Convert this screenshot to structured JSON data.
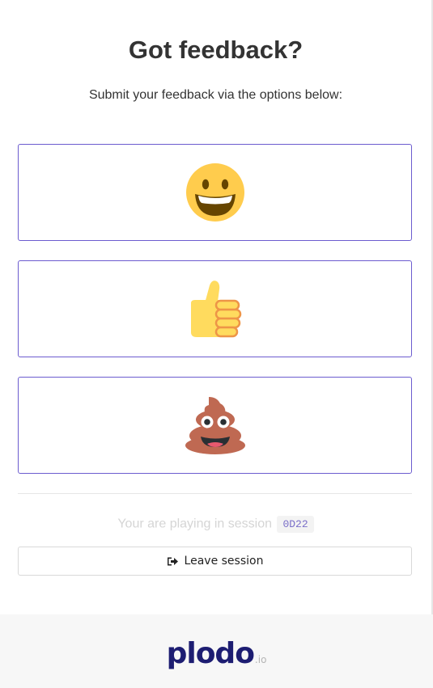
{
  "header": {
    "title": "Got feedback?",
    "subtitle": "Submit your feedback via the options below:"
  },
  "feedback_options": [
    {
      "icon": "grinning-face-emoji"
    },
    {
      "icon": "thumbs-up-emoji"
    },
    {
      "icon": "pile-of-poo-emoji"
    }
  ],
  "session": {
    "text": "Your are playing in session",
    "code": "0D22"
  },
  "leave_button": {
    "label": "Leave session",
    "icon": "sign-out-icon"
  },
  "footer": {
    "logo_text": "plodo",
    "logo_suffix": ".io"
  },
  "colors": {
    "accent_border": "#6c5ccf",
    "brand": "#1d1d72",
    "session_code": "#7b6fc9"
  }
}
